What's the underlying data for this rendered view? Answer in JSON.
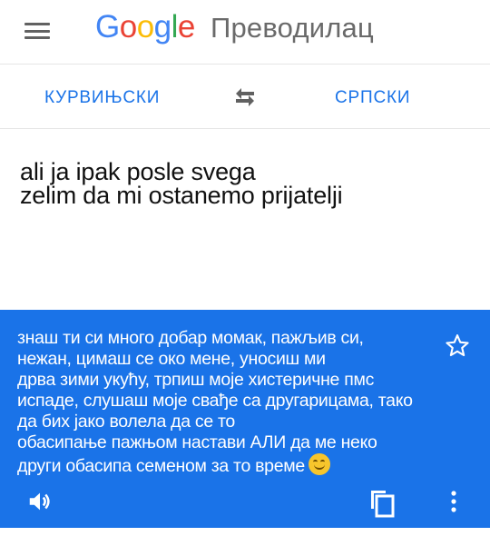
{
  "app": {
    "logo_letters": [
      {
        "char": "G",
        "color": "#4285f4"
      },
      {
        "char": "o",
        "color": "#ea4335"
      },
      {
        "char": "o",
        "color": "#fbbc05"
      },
      {
        "char": "g",
        "color": "#4285f4"
      },
      {
        "char": "l",
        "color": "#34a853"
      },
      {
        "char": "e",
        "color": "#ea4335"
      }
    ],
    "product_name": "Преводилац"
  },
  "icons": {
    "menu": "hamburger-menu-icon",
    "swap": "swap-arrows-icon",
    "star": "star-outline-icon",
    "speaker": "speaker-icon",
    "copy": "copy-icon",
    "more": "more-vertical-icon",
    "emoji": "smiling-face-emoji"
  },
  "languages": {
    "source": "КУРВИЊСКИ",
    "target": "СРПСКИ"
  },
  "source_text": {
    "lines": [
      "ali ja ipak posle svega",
      "zelim da mi ostanemo prijatelji"
    ]
  },
  "translation": {
    "lines": [
      "знаш ти си много добар момак, пажљив си,",
      "нежан, цимаш се око мене, уносиш ми",
      "дрва зими укућу, трпиш моје хистеричне пмс",
      "испаде, слушаш моје свађе са другарицама, тако",
      "да бих јако волела да се то",
      "обасипање пажњом настави АЛИ да ме неко",
      "други обасипа семеном за то време"
    ]
  },
  "colors": {
    "accent": "#1a73e8",
    "result_background": "#1a73e8",
    "result_text": "#ffffff",
    "icon_gray": "#616161"
  }
}
